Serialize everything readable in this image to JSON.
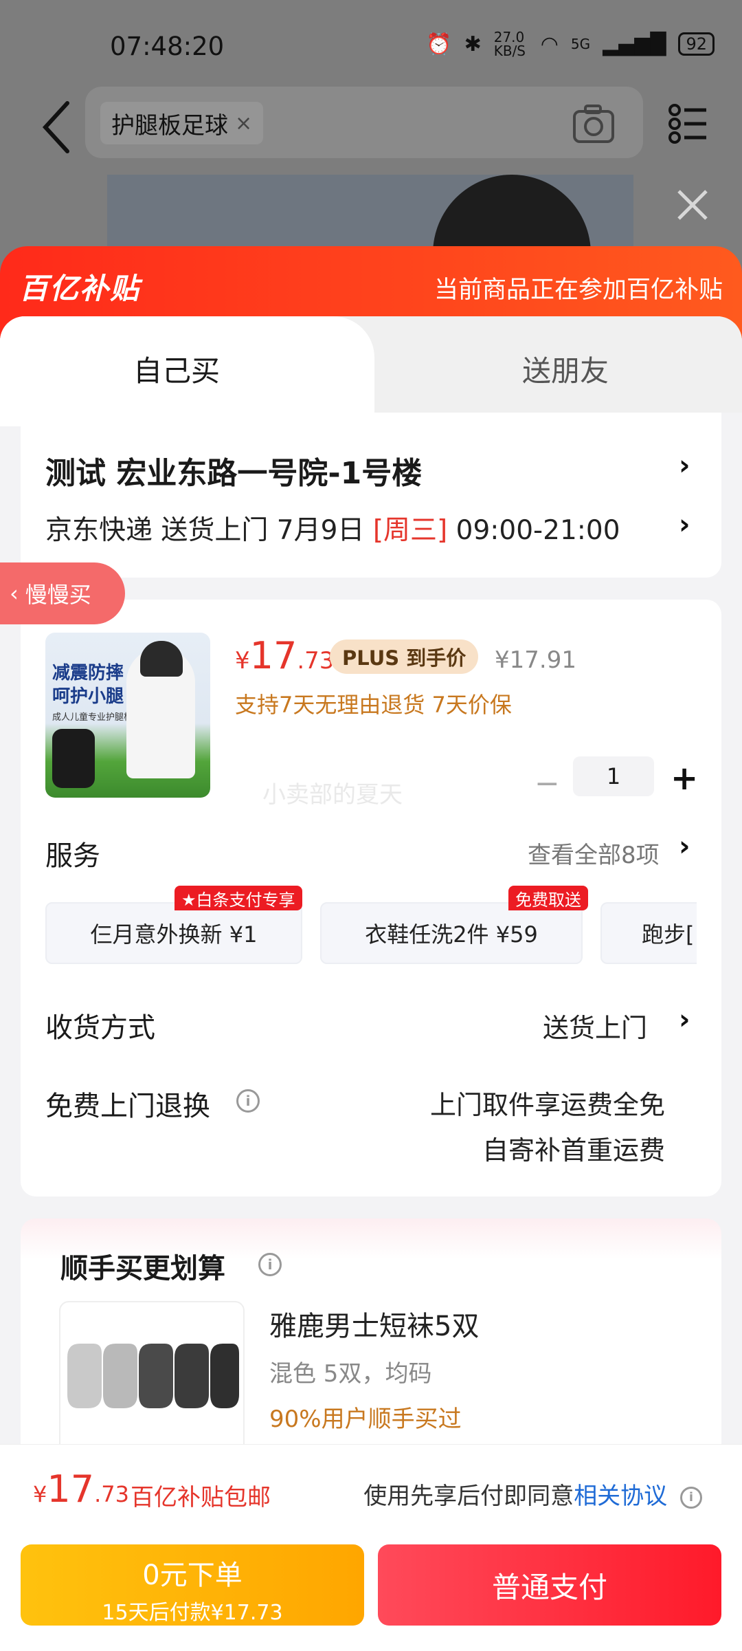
{
  "status_bar": {
    "time": "07:48:20",
    "net_speed": "27.0 KB/S",
    "signal": "5G",
    "battery": "92"
  },
  "search": {
    "query": "护腿板足球"
  },
  "banner": {
    "logo": "百亿补贴",
    "text": "当前商品正在参加百亿补贴"
  },
  "tabs": [
    {
      "label": "自己买",
      "active": true
    },
    {
      "label": "送朋友",
      "active": false
    }
  ],
  "address": {
    "line1": "测试  宏业东路一号院-1号楼",
    "delivery_prefix": "京东快递 送货上门 7月9日 ",
    "delivery_weekday": "[周三]",
    "delivery_time": " 09:00-21:00"
  },
  "slow_buy": {
    "label": "慢慢买"
  },
  "product": {
    "thumb_text1": "减震防摔",
    "thumb_text2": "呵护小腿",
    "thumb_text3": "成人儿童专业护腿板",
    "price_symbol": "¥",
    "price_int": "17",
    "price_dec": ".73",
    "plus_badge": "PLUS 到手价",
    "orig_price": "¥17.91",
    "service_line": "支持7天无理由退货  7天价保",
    "quantity": "1",
    "watermark": "小卖部的夏天"
  },
  "services": {
    "title": "服务",
    "view_all": "查看全部8项",
    "items": [
      {
        "label": "仨月意外换新  ¥1",
        "tag": "★白条支付专享"
      },
      {
        "label": "衣鞋任洗2件  ¥59",
        "tag": "免费取送"
      },
      {
        "label": "跑步[",
        "tag": ""
      }
    ]
  },
  "delivery_method": {
    "title": "收货方式",
    "value": "送货上门"
  },
  "free_return": {
    "title": "免费上门退换",
    "line1": "上门取件享运费全免",
    "line2": "自寄补首重运费"
  },
  "addon": {
    "title": "顺手买更划算",
    "name": "雅鹿男士短袜5双",
    "spec": "混色 5双，均码",
    "note": "90%用户顺手买过"
  },
  "bottom": {
    "price_symbol": "¥",
    "price_int": "17",
    "price_dec": ".73",
    "note": "百亿补贴包邮",
    "agree_prefix": "使用先享后付即同意",
    "agree_link": "相关协议",
    "btn_later_l1": "0元下单",
    "btn_later_l2": "15天后付款¥17.73",
    "btn_pay": "普通支付"
  },
  "colors": {
    "brand_red": "#e5352b",
    "banner": "#ff3b1c",
    "pay_button": "#ff2a3a",
    "later_button": "#ffb400"
  }
}
